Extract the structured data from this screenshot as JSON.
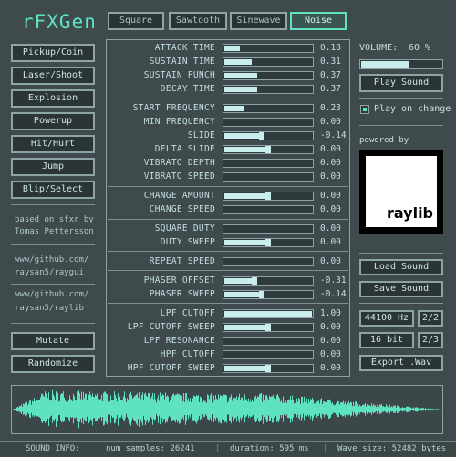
{
  "app": {
    "title": "rFXGen"
  },
  "wave_tabs": [
    {
      "label": "Square"
    },
    {
      "label": "Sawtooth"
    },
    {
      "label": "Sinewave"
    },
    {
      "label": "Noise"
    }
  ],
  "active_wave_tab": "Noise",
  "presets": [
    {
      "label": "Pickup/Coin"
    },
    {
      "label": "Laser/Shoot"
    },
    {
      "label": "Explosion"
    },
    {
      "label": "Powerup"
    },
    {
      "label": "Hit/Hurt"
    },
    {
      "label": "Jump"
    },
    {
      "label": "Blip/Select"
    }
  ],
  "info": {
    "line1": "based on sfxr by",
    "line2": "Tomas Pettersson",
    "link1a": "www/github.com/",
    "link1b": "raysan5/raygui",
    "link2a": "www/github.com/",
    "link2b": "raysan5/raylib"
  },
  "actions": {
    "mutate": "Mutate",
    "randomize": "Randomize"
  },
  "params": [
    {
      "label": "ATTACK TIME",
      "value": "0.18",
      "level": 0.18,
      "kind": "fill"
    },
    {
      "label": "SUSTAIN TIME",
      "value": "0.31",
      "level": 0.31,
      "kind": "fill"
    },
    {
      "label": "SUSTAIN PUNCH",
      "value": "0.37",
      "level": 0.37,
      "kind": "fill"
    },
    {
      "label": "DECAY TIME",
      "value": "0.37",
      "level": 0.37,
      "kind": "fill"
    },
    {
      "label": "START FREQUENCY",
      "value": "0.23",
      "level": 0.23,
      "kind": "fill"
    },
    {
      "label": "MIN FREQUENCY",
      "value": "0.00",
      "level": 0.0,
      "kind": "fill"
    },
    {
      "label": "SLIDE",
      "value": "-0.14",
      "level": -0.14,
      "kind": "signed"
    },
    {
      "label": "DELTA SLIDE",
      "value": "0.00",
      "level": 0.0,
      "kind": "signed"
    },
    {
      "label": "VIBRATO DEPTH",
      "value": "0.00",
      "level": 0.0,
      "kind": "fill"
    },
    {
      "label": "VIBRATO SPEED",
      "value": "0.00",
      "level": 0.0,
      "kind": "fill"
    },
    {
      "label": "CHANGE AMOUNT",
      "value": "0.00",
      "level": 0.0,
      "kind": "signed"
    },
    {
      "label": "CHANGE SPEED",
      "value": "0.00",
      "level": 0.0,
      "kind": "fill"
    },
    {
      "label": "SQUARE DUTY",
      "value": "0.00",
      "level": 0.0,
      "kind": "fill"
    },
    {
      "label": "DUTY SWEEP",
      "value": "0.00",
      "level": 0.0,
      "kind": "signed"
    },
    {
      "label": "REPEAT SPEED",
      "value": "0.00",
      "level": 0.0,
      "kind": "fill"
    },
    {
      "label": "PHASER OFFSET",
      "value": "-0.31",
      "level": -0.31,
      "kind": "signed"
    },
    {
      "label": "PHASER SWEEP",
      "value": "-0.14",
      "level": -0.14,
      "kind": "signed"
    },
    {
      "label": "LPF CUTOFF",
      "value": "1.00",
      "level": 1.0,
      "kind": "fill"
    },
    {
      "label": "LPF CUTOFF SWEEP",
      "value": "0.00",
      "level": 0.0,
      "kind": "signed"
    },
    {
      "label": "LPF RESONANCE",
      "value": "0.00",
      "level": 0.0,
      "kind": "fill"
    },
    {
      "label": "HPF CUTOFF",
      "value": "0.00",
      "level": 0.0,
      "kind": "fill"
    },
    {
      "label": "HPF CUTOFF SWEEP",
      "value": "0.00",
      "level": 0.0,
      "kind": "signed"
    }
  ],
  "volume": {
    "label": "VOLUME:",
    "value": "60 %",
    "level": 0.6
  },
  "play_sound": "Play Sound",
  "play_on_change": {
    "label": "Play on change",
    "checked": true
  },
  "powered_by": "powered by",
  "raylib_logo": "raylib",
  "file_buttons": {
    "load": "Load Sound",
    "save": "Save Sound"
  },
  "export": {
    "sample_rate": "44100 Hz",
    "sample_rate_page": "2/2",
    "bit_depth": "16 bit",
    "bit_depth_page": "2/3",
    "export_label": "Export .Wav"
  },
  "status": {
    "info_label": "SOUND INFO:",
    "samples": "num samples: 26241",
    "duration": "duration: 595 ms",
    "wave_size": "Wave size: 52482 bytes"
  },
  "colors": {
    "background": "#3e4a4c",
    "accent": "#5fe2c0",
    "waveform": "#5fe2c0",
    "border": "#8ea3a6",
    "slider_fill": "#c9ecec"
  }
}
